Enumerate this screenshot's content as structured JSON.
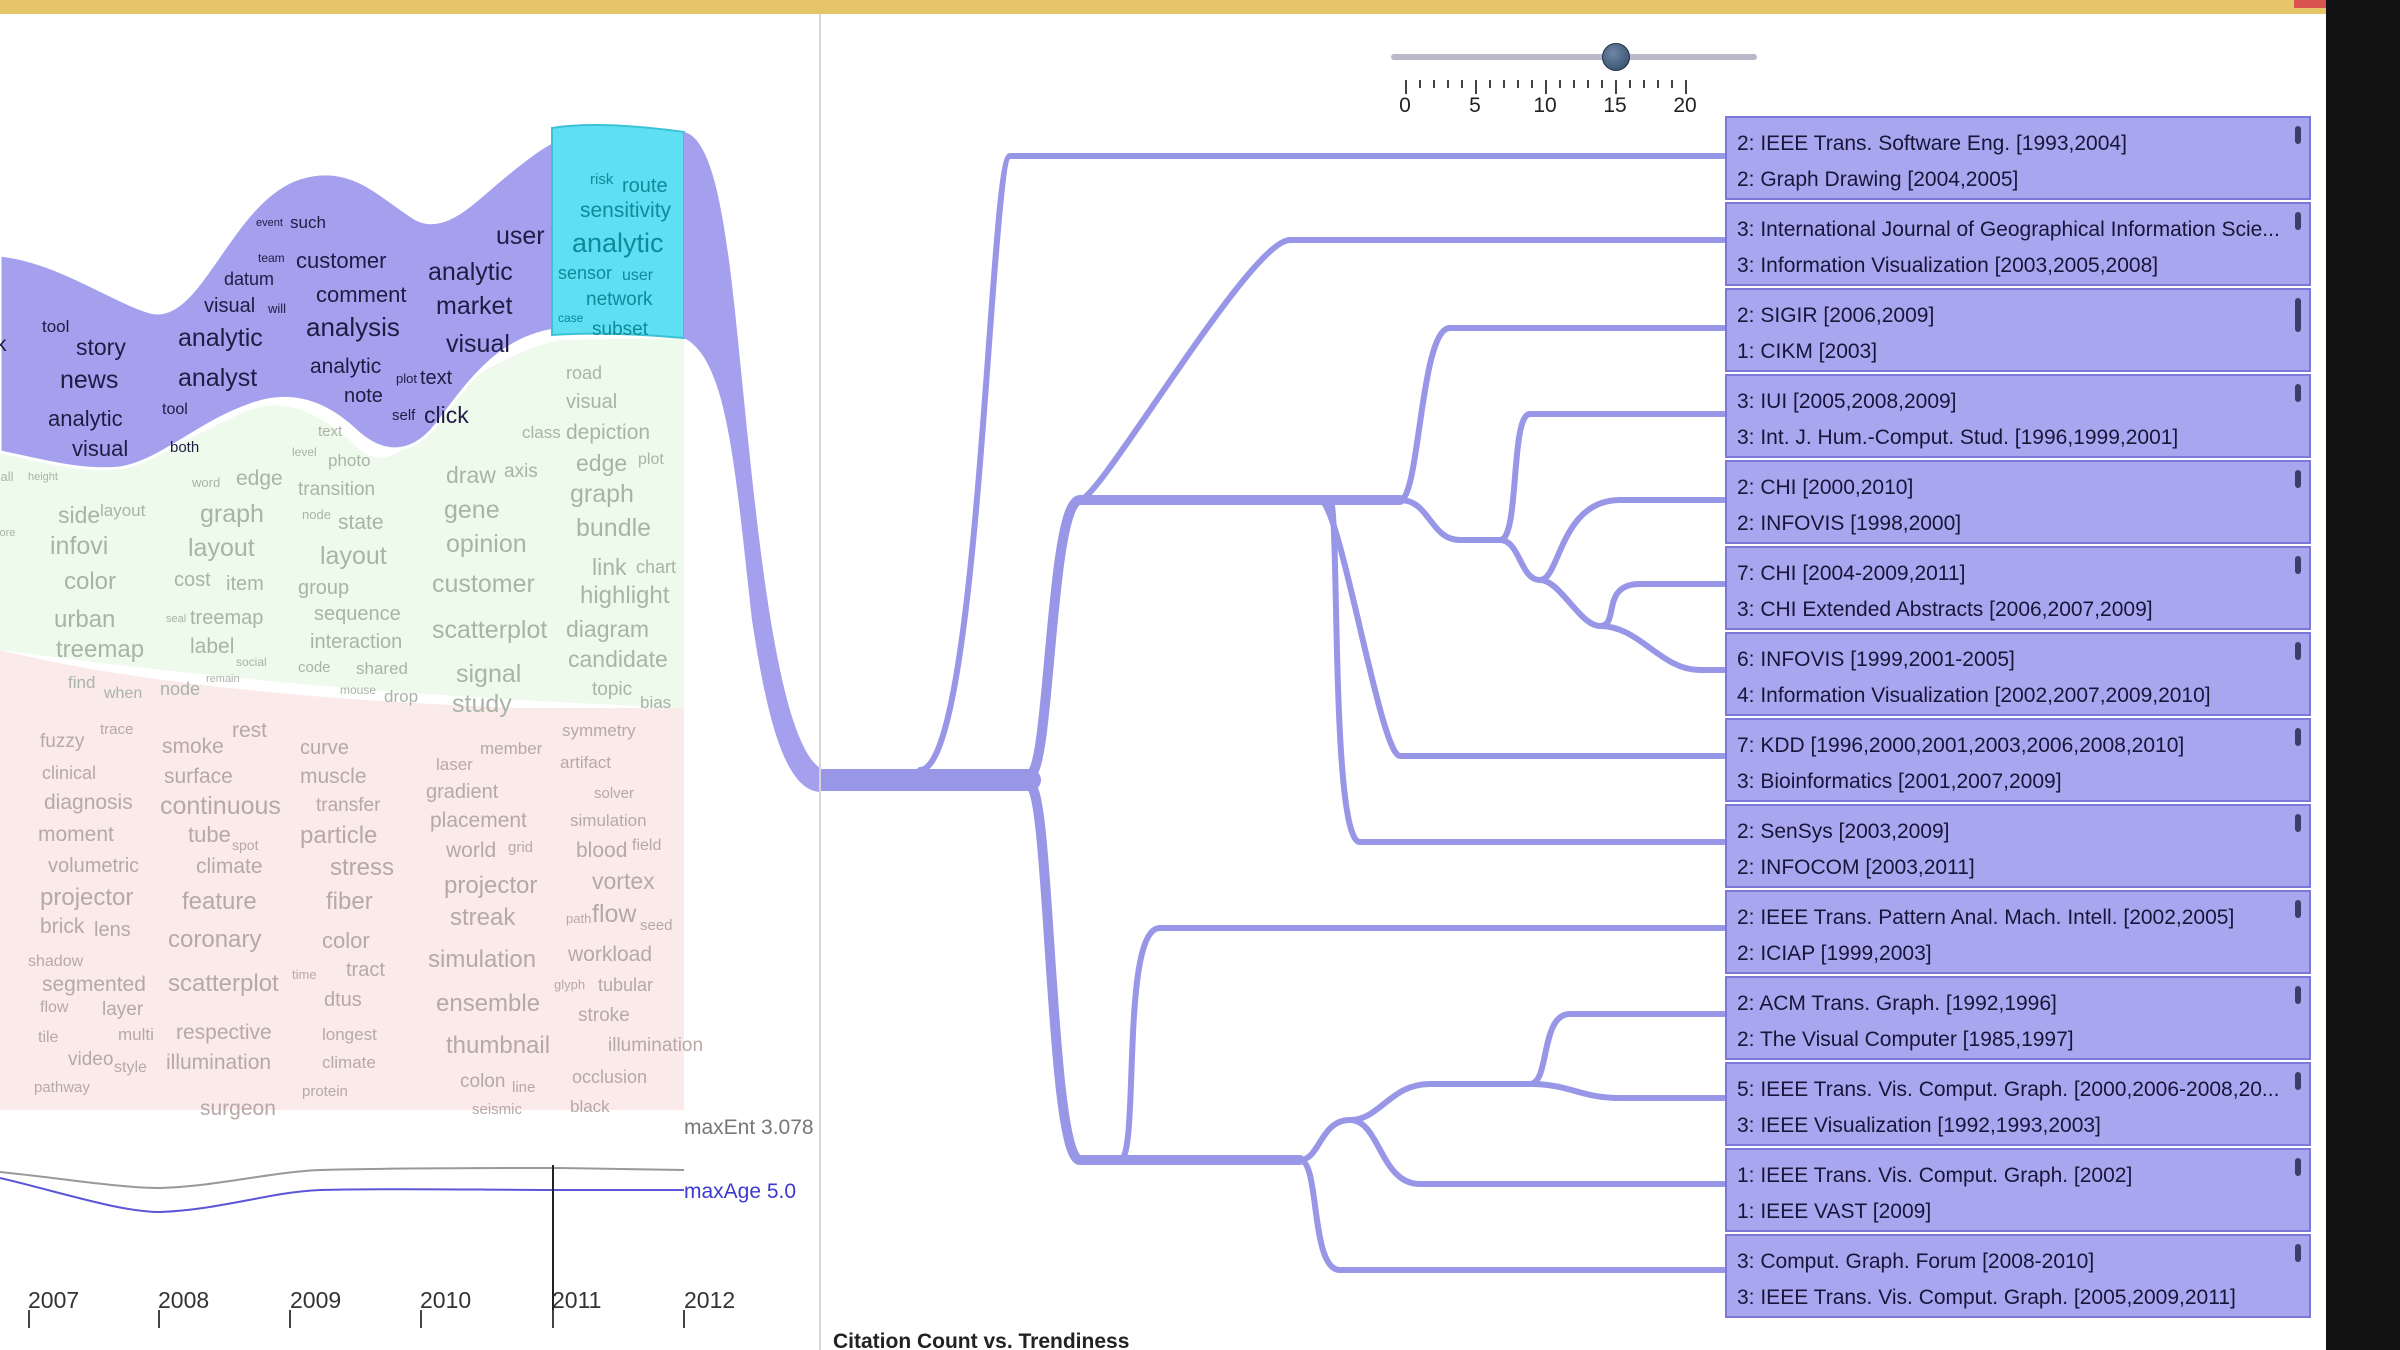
{
  "slider": {
    "min": 0,
    "max": 20,
    "value": 15,
    "tick_labels": [
      "0",
      "5",
      "10",
      "15",
      "20"
    ]
  },
  "metrics": {
    "max_entropy": "maxEnt 3.078",
    "max_age": "maxAge 5.0"
  },
  "timeline": {
    "years": [
      "2007",
      "2008",
      "2009",
      "2010",
      "2011",
      "2012"
    ],
    "selected_year": "2011"
  },
  "chart_title": "Citation Count vs. Trendiness",
  "topic_words": {
    "dark": [
      "k",
      "tool",
      "story",
      "news",
      "analytic",
      "visual",
      "datum",
      "visual",
      "will",
      "analytic",
      "analyst",
      "tool",
      "both",
      "event",
      "such",
      "team",
      "customer",
      "comment",
      "analysis",
      "analytic",
      "plot",
      "text",
      "note",
      "self",
      "click",
      "user",
      "analytic",
      "market",
      "visual"
    ],
    "teal": [
      "risk",
      "route",
      "sensitivity",
      "analytic",
      "sensor",
      "user",
      "network",
      "case",
      "subset"
    ],
    "green": [
      "call",
      "height",
      "side",
      "layout",
      "core",
      "infovi",
      "color",
      "urban",
      "treemap",
      "find",
      "when",
      "word",
      "edge",
      "graph",
      "layout",
      "cost",
      "item",
      "seal",
      "treemap",
      "label",
      "social",
      "node",
      "remain",
      "level",
      "photo",
      "transition",
      "text",
      "node",
      "state",
      "layout",
      "group",
      "sequence",
      "interaction",
      "code",
      "shared",
      "mouse",
      "drop",
      "draw",
      "axis",
      "gene",
      "opinion",
      "customer",
      "scatterplot",
      "signal",
      "study",
      "class",
      "road",
      "visual",
      "depiction",
      "edge",
      "plot",
      "graph",
      "bundle",
      "link",
      "chart",
      "highlight",
      "diagram",
      "candidate",
      "topic",
      "bias"
    ],
    "red": [
      "fuzzy",
      "trace",
      "clinical",
      "diagnosis",
      "moment",
      "volumetric",
      "projector",
      "brick",
      "lens",
      "shadow",
      "segmented",
      "flow",
      "layer",
      "tile",
      "multi",
      "video",
      "style",
      "pathway",
      "smoke",
      "rest",
      "surface",
      "continuous",
      "tube",
      "spot",
      "climate",
      "feature",
      "coronary",
      "scatterplot",
      "respective",
      "illumination",
      "surgeon",
      "curve",
      "muscle",
      "transfer",
      "particle",
      "stress",
      "fiber",
      "color",
      "time",
      "tract",
      "dtus",
      "longest",
      "climate",
      "protein",
      "laser",
      "member",
      "gradient",
      "placement",
      "world",
      "grid",
      "projector",
      "streak",
      "simulation",
      "ensemble",
      "thumbnail",
      "colon",
      "line",
      "seismic",
      "symmetry",
      "artifact",
      "solver",
      "simulation",
      "blood",
      "field",
      "vortex",
      "path",
      "flow",
      "seed",
      "workload",
      "glyph",
      "tubular",
      "stroke",
      "illumination",
      "occlusion",
      "black"
    ]
  },
  "venues": [
    {
      "line1": "2: IEEE Trans. Software Eng. [1993,2004]",
      "line2": "2: Graph Drawing [2004,2005]"
    },
    {
      "line1": "3: International Journal of Geographical Information Scie...",
      "line2": "3: Information Visualization [2003,2005,2008]"
    },
    {
      "line1": "2: SIGIR [2006,2009]",
      "line2": "1: CIKM [2003]"
    },
    {
      "line1": "3: IUI [2005,2008,2009]",
      "line2": "3: Int. J. Hum.-Comput. Stud. [1996,1999,2001]"
    },
    {
      "line1": "2: CHI [2000,2010]",
      "line2": "2: INFOVIS [1998,2000]"
    },
    {
      "line1": "7: CHI [2004-2009,2011]",
      "line2": "3: CHI Extended Abstracts [2006,2007,2009]"
    },
    {
      "line1": "6: INFOVIS [1999,2001-2005]",
      "line2": "4: Information Visualization [2002,2007,2009,2010]"
    },
    {
      "line1": "7: KDD [1996,2000,2001,2003,2006,2008,2010]",
      "line2": "3: Bioinformatics [2001,2007,2009]"
    },
    {
      "line1": "2: SenSys [2003,2009]",
      "line2": "2: INFOCOM [2003,2011]"
    },
    {
      "line1": "2: IEEE Trans. Pattern Anal. Mach. Intell. [2002,2005]",
      "line2": "2: ICIAP [1999,2003]"
    },
    {
      "line1": "2: ACM Trans. Graph. [1992,1996]",
      "line2": "2: The Visual Computer [1985,1997]"
    },
    {
      "line1": "5: IEEE Trans. Vis. Comput. Graph. [2000,2006-2008,20...",
      "line2": "3: IEEE Visualization [1992,1993,2003]"
    },
    {
      "line1": "1: IEEE Trans. Vis. Comput. Graph. [2002]",
      "line2": "1: IEEE VAST [2009]"
    },
    {
      "line1": "3: Comput. Graph. Forum [2008-2010]",
      "line2": "3: IEEE Trans. Vis. Comput. Graph. [2005,2009,2011]"
    }
  ],
  "colors": {
    "dark_band": "#a4a0ee",
    "teal_band": "#5ee0f2",
    "green_band": "#eefaec",
    "red_band": "#fbeaea",
    "tree_stroke": "#9896e6",
    "venue_fill": "#a8a6ee"
  }
}
